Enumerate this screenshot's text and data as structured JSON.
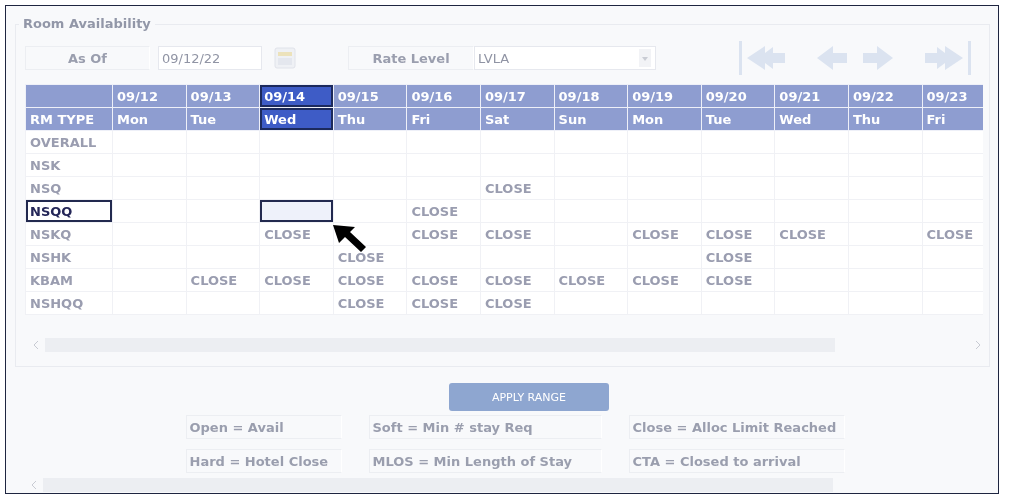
{
  "panel": {
    "title": "Room Availability"
  },
  "toolbar": {
    "as_of_label": "As Of",
    "as_of_value": "09/12/22",
    "rate_level_label": "Rate Level",
    "rate_level_value": "LVLA"
  },
  "grid": {
    "corner_label": "RM TYPE",
    "columns": [
      {
        "date": "09/12",
        "day": "Mon",
        "selected": false
      },
      {
        "date": "09/13",
        "day": "Tue",
        "selected": false
      },
      {
        "date": "09/14",
        "day": "Wed",
        "selected": true
      },
      {
        "date": "09/15",
        "day": "Thu",
        "selected": false
      },
      {
        "date": "09/16",
        "day": "Fri",
        "selected": false
      },
      {
        "date": "09/17",
        "day": "Sat",
        "selected": false
      },
      {
        "date": "09/18",
        "day": "Sun",
        "selected": false
      },
      {
        "date": "09/19",
        "day": "Mon",
        "selected": false
      },
      {
        "date": "09/20",
        "day": "Tue",
        "selected": false
      },
      {
        "date": "09/21",
        "day": "Wed",
        "selected": false
      },
      {
        "date": "09/22",
        "day": "Thu",
        "selected": false
      },
      {
        "date": "09/23",
        "day": "Fri",
        "selected": false
      }
    ],
    "rows": [
      {
        "name": "OVERALL",
        "selected": false,
        "cells": [
          {
            "selected": false
          },
          {
            "selected": false
          },
          {
            "selected": false
          },
          {
            "selected": false
          },
          {
            "selected": false
          },
          {
            "selected": false
          },
          {
            "selected": false
          },
          {
            "selected": false
          },
          {
            "selected": false
          },
          {
            "selected": false
          },
          {
            "selected": false
          },
          {
            "selected": false
          }
        ]
      },
      {
        "name": "NSK",
        "selected": false,
        "cells": [
          {
            "selected": false
          },
          {
            "selected": false
          },
          {
            "selected": false
          },
          {
            "selected": false
          },
          {
            "selected": false
          },
          {
            "selected": false
          },
          {
            "selected": false
          },
          {
            "selected": false
          },
          {
            "selected": false
          },
          {
            "selected": false
          },
          {
            "selected": false
          },
          {
            "selected": false
          }
        ]
      },
      {
        "name": "NSQ",
        "selected": false,
        "cells": [
          {
            "selected": false
          },
          {
            "selected": false
          },
          {
            "selected": false
          },
          {
            "selected": false
          },
          {
            "selected": false
          },
          {
            "value": "CLOSE",
            "selected": false
          },
          {
            "selected": false
          },
          {
            "selected": false
          },
          {
            "selected": false
          },
          {
            "selected": false
          },
          {
            "selected": false
          },
          {
            "selected": false
          }
        ]
      },
      {
        "name": "NSQQ",
        "selected": true,
        "cells": [
          {
            "selected": false
          },
          {
            "selected": false
          },
          {
            "selected": true
          },
          {
            "selected": false
          },
          {
            "value": "CLOSE",
            "selected": false
          },
          {
            "selected": false
          },
          {
            "selected": false
          },
          {
            "selected": false
          },
          {
            "selected": false
          },
          {
            "selected": false
          },
          {
            "selected": false
          },
          {
            "selected": false
          }
        ]
      },
      {
        "name": "NSKQ",
        "selected": false,
        "cells": [
          {
            "selected": false
          },
          {
            "selected": false
          },
          {
            "value": "CLOSE",
            "selected": false
          },
          {
            "selected": false
          },
          {
            "value": "CLOSE",
            "selected": false
          },
          {
            "value": "CLOSE",
            "selected": false
          },
          {
            "selected": false
          },
          {
            "value": "CLOSE",
            "selected": false
          },
          {
            "value": "CLOSE",
            "selected": false
          },
          {
            "value": "CLOSE",
            "selected": false
          },
          {
            "selected": false
          },
          {
            "value": "CLOSE",
            "selected": false
          }
        ]
      },
      {
        "name": "NSHK",
        "selected": false,
        "cells": [
          {
            "selected": false
          },
          {
            "selected": false
          },
          {
            "selected": false
          },
          {
            "value": "CLOSE",
            "selected": false
          },
          {
            "selected": false
          },
          {
            "selected": false
          },
          {
            "selected": false
          },
          {
            "selected": false
          },
          {
            "value": "CLOSE",
            "selected": false
          },
          {
            "selected": false
          },
          {
            "selected": false
          },
          {
            "selected": false
          }
        ]
      },
      {
        "name": "KBAM",
        "selected": false,
        "cells": [
          {
            "selected": false
          },
          {
            "value": "CLOSE",
            "selected": false
          },
          {
            "value": "CLOSE",
            "selected": false
          },
          {
            "value": "CLOSE",
            "selected": false
          },
          {
            "value": "CLOSE",
            "selected": false
          },
          {
            "value": "CLOSE",
            "selected": false
          },
          {
            "value": "CLOSE",
            "selected": false
          },
          {
            "value": "CLOSE",
            "selected": false
          },
          {
            "value": "CLOSE",
            "selected": false
          },
          {
            "selected": false
          },
          {
            "selected": false
          },
          {
            "selected": false
          }
        ]
      },
      {
        "name": "NSHQQ",
        "selected": false,
        "cells": [
          {
            "selected": false
          },
          {
            "selected": false
          },
          {
            "selected": false
          },
          {
            "value": "CLOSE",
            "selected": false
          },
          {
            "value": "CLOSE",
            "selected": false
          },
          {
            "value": "CLOSE",
            "selected": false
          },
          {
            "selected": false
          },
          {
            "selected": false
          },
          {
            "selected": false
          },
          {
            "selected": false
          },
          {
            "selected": false
          },
          {
            "selected": false
          }
        ]
      }
    ]
  },
  "apply_button": "APPLY RANGE",
  "legend": [
    "Open = Avail",
    "Soft = Min # stay Req",
    "Close = Alloc Limit Reached",
    "Hard = Hotel Close",
    "MLOS = Min Length of Stay",
    "CTA = Closed to arrival"
  ]
}
